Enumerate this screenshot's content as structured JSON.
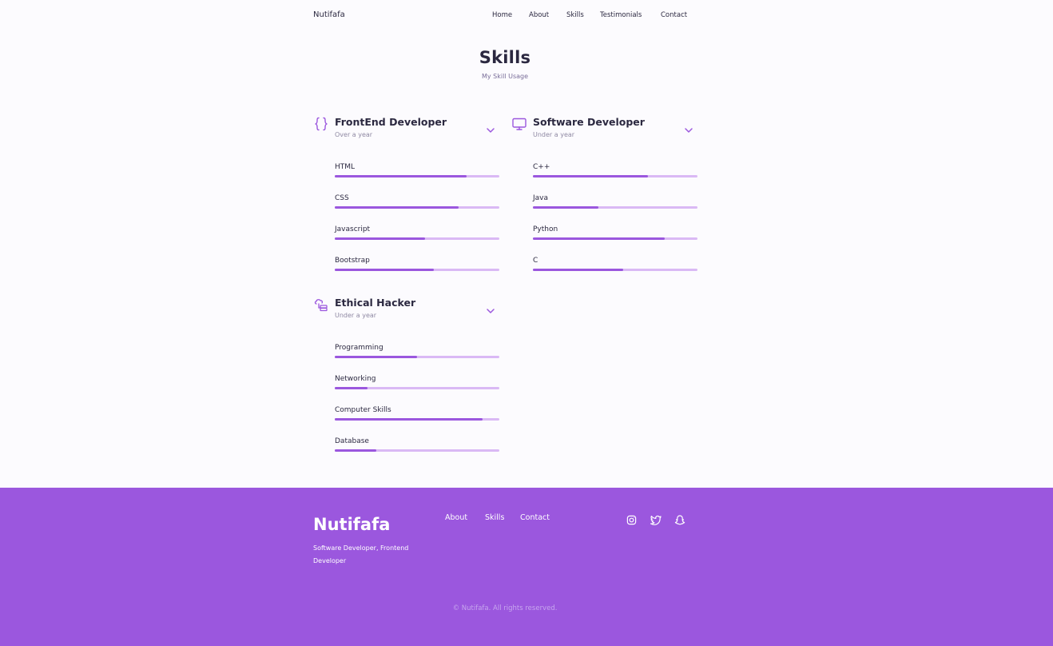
{
  "header": {
    "logo": "Nutifafa",
    "nav": [
      {
        "label": "Home"
      },
      {
        "label": "About"
      },
      {
        "label": "Skills"
      },
      {
        "label": "Testimonials"
      },
      {
        "label": "Contact"
      }
    ]
  },
  "section": {
    "title": "Skills",
    "subtitle": "My Skill Usage"
  },
  "groups": [
    {
      "title": "FrontEnd Developer",
      "subtitle": "Over a year",
      "icon": "code-braces-icon",
      "skills": [
        {
          "name": "HTML",
          "level": 80
        },
        {
          "name": "CSS",
          "level": 75
        },
        {
          "name": "Javascript",
          "level": 55
        },
        {
          "name": "Bootstrap",
          "level": 60
        }
      ]
    },
    {
      "title": "Software Developer",
      "subtitle": "Under a year",
      "icon": "monitor-icon",
      "skills": [
        {
          "name": "C++",
          "level": 70
        },
        {
          "name": "Java",
          "level": 40
        },
        {
          "name": "Python",
          "level": 80
        },
        {
          "name": "C",
          "level": 55
        }
      ]
    },
    {
      "title": "Ethical Hacker",
      "subtitle": "Under a year",
      "icon": "server-network-icon",
      "skills": [
        {
          "name": "Programming",
          "level": 50
        },
        {
          "name": "Networking",
          "level": 20
        },
        {
          "name": "Computer Skills",
          "level": 90
        },
        {
          "name": "Database",
          "level": 25
        }
      ]
    }
  ],
  "footer": {
    "title": "Nutifafa",
    "subtitle": "Software Developer, Frontend Developer",
    "links": [
      {
        "label": "About"
      },
      {
        "label": "Skills"
      },
      {
        "label": "Contact"
      }
    ],
    "social": [
      "instagram-icon",
      "twitter-icon",
      "snapchat-icon"
    ],
    "copyright": "© Nutifafa. All rights reserved."
  },
  "colors": {
    "accent": "#9b57de",
    "track": "#dab9f5",
    "text": "#2b2840",
    "background": "#fcfbfe"
  }
}
